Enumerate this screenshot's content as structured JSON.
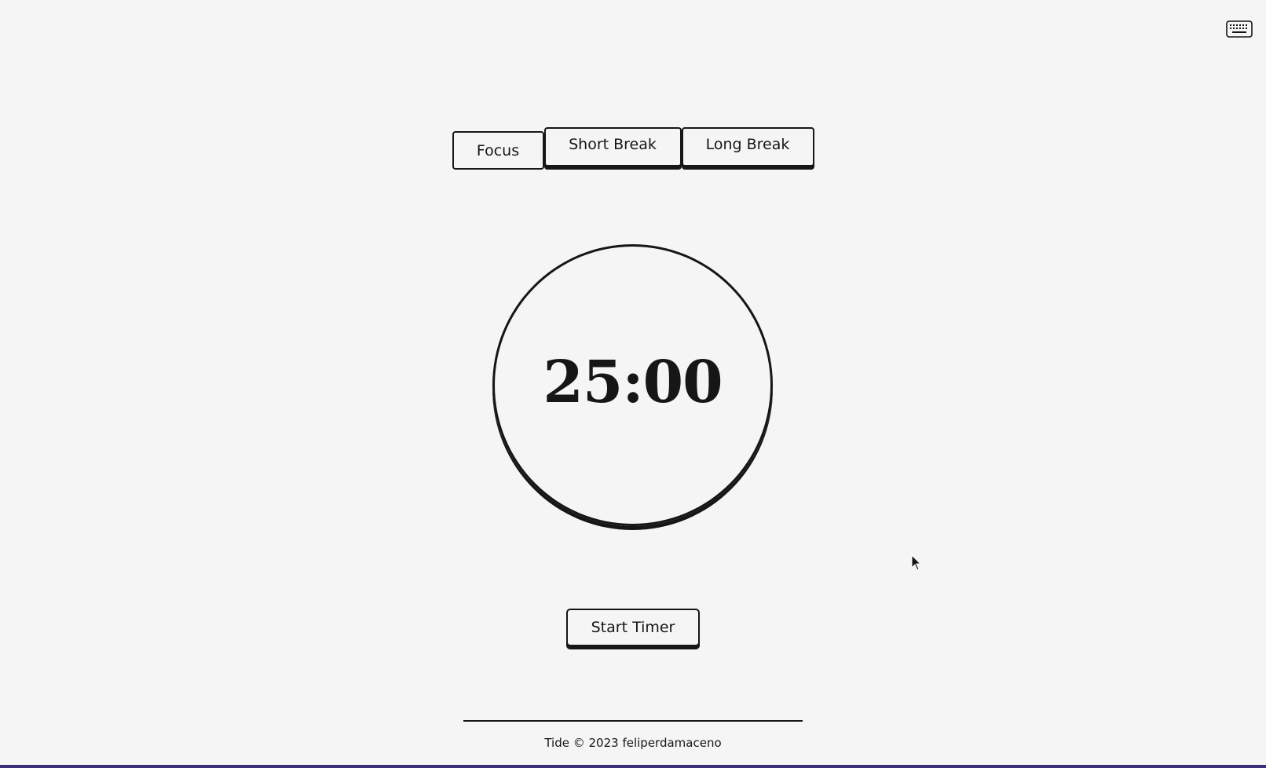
{
  "header": {
    "keyboard_icon": "keyboard-icon"
  },
  "tabs": [
    {
      "label": "Focus",
      "active": true
    },
    {
      "label": "Short Break",
      "active": false
    },
    {
      "label": "Long Break",
      "active": false
    }
  ],
  "timer": {
    "display": "25:00"
  },
  "controls": {
    "start_label": "Start Timer"
  },
  "footer": {
    "text": "Tide © 2023 feliperdamaceno"
  },
  "colors": {
    "background": "#f5f5f5",
    "ink": "#161616",
    "window_edge": "#3a2f7a"
  }
}
